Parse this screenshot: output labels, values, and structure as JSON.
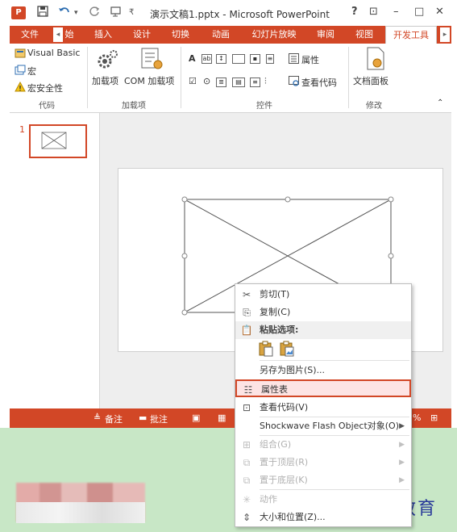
{
  "titlebar": {
    "title": "演示文稿1.pptx - Microsoft PowerPoint",
    "logo": "P",
    "undo_icon": "undo-icon",
    "redo_icon": "redo-icon",
    "help": "?",
    "restore": "⊡",
    "minimize": "–",
    "maximize": "□",
    "close": "✕"
  },
  "tabs": [
    {
      "label": "文件"
    },
    {
      "label": "始"
    },
    {
      "label": "插入"
    },
    {
      "label": "设计"
    },
    {
      "label": "切换"
    },
    {
      "label": "动画"
    },
    {
      "label": "幻灯片放映"
    },
    {
      "label": "审阅"
    },
    {
      "label": "视图"
    },
    {
      "label": "开发工具"
    }
  ],
  "ribbon": {
    "code": {
      "visual_basic": "Visual Basic",
      "macro": "宏",
      "macro_security": "宏安全性",
      "label": "代码"
    },
    "addins": {
      "addins": "加载项",
      "com_addins": "COM 加载项",
      "label": "加载项"
    },
    "controls": {
      "properties": "属性",
      "view_code": "查看代码",
      "label": "控件"
    },
    "modify": {
      "doc_panel": "文档面板",
      "label": "修改"
    }
  },
  "thumbnail": {
    "number": "1"
  },
  "statusbar": {
    "notes": "备注",
    "comments": "批注",
    "zoom_partial": "%"
  },
  "context_menu": {
    "items": [
      {
        "label": "剪切(T)",
        "icon": "scissors-icon"
      },
      {
        "label": "复制(C)",
        "icon": "copy-icon"
      },
      {
        "label": "粘贴选项:",
        "icon": "paste-icon"
      },
      {
        "label": "另存为图片(S)..."
      },
      {
        "label": "属性表",
        "icon": "property-sheet-icon"
      },
      {
        "label": "查看代码(V)",
        "icon": "view-code-icon"
      },
      {
        "label": "Shockwave Flash Object对象(O)"
      },
      {
        "label": "组合(G)",
        "icon": "group-icon"
      },
      {
        "label": "置于顶层(R)",
        "icon": "bring-front-icon"
      },
      {
        "label": "置于底层(K)",
        "icon": "send-back-icon"
      },
      {
        "label": "动作",
        "icon": "action-icon"
      },
      {
        "label": "大小和位置(Z)...",
        "icon": "size-position-icon"
      }
    ]
  },
  "watermark": "最需教育"
}
